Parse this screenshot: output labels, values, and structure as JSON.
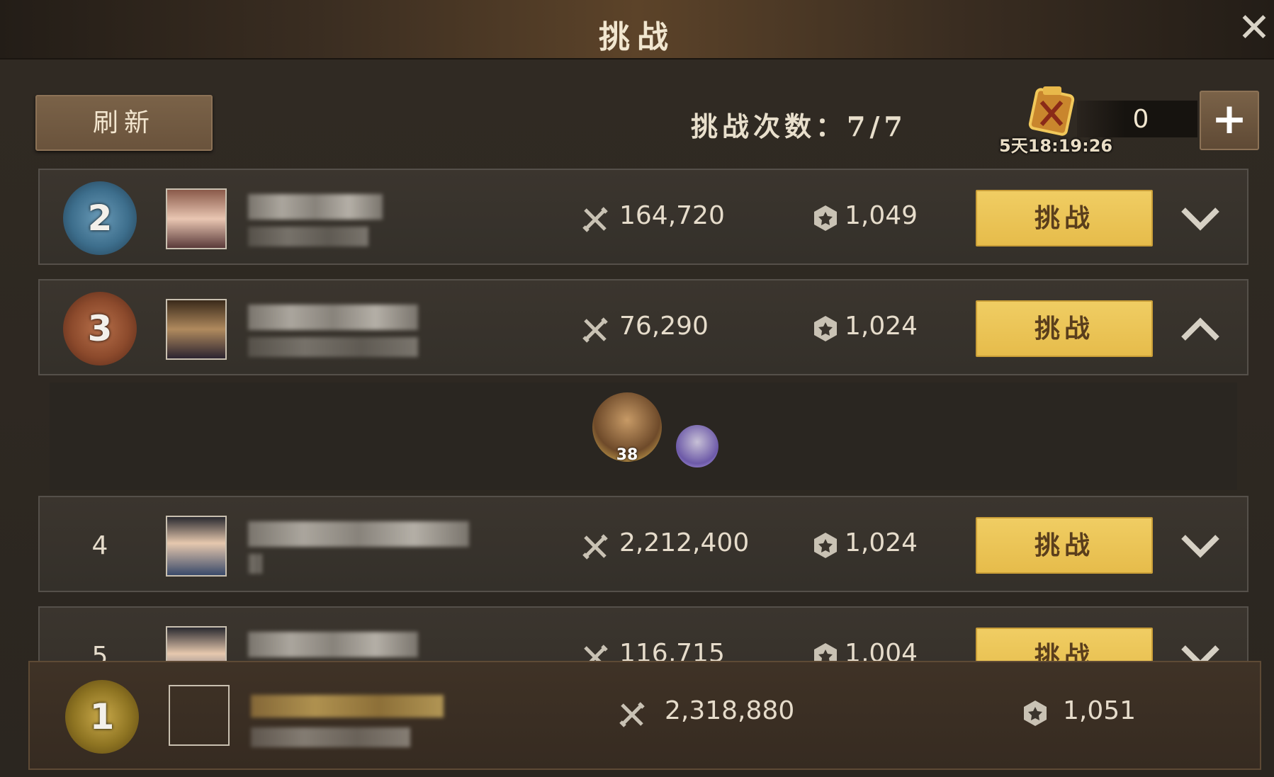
{
  "header": {
    "title": "挑战"
  },
  "toolbar": {
    "refresh_label": "刷新",
    "attempts_text": "挑战次数：7/7",
    "token_count": "0",
    "token_timer": "5天18:19:26",
    "plus_label": "+"
  },
  "rows": [
    {
      "rank": "2",
      "power": "164,720",
      "score": "1,049",
      "button": "挑战",
      "chevron": "down"
    },
    {
      "rank": "3",
      "power": "76,290",
      "score": "1,024",
      "button": "挑战",
      "chevron": "up"
    },
    {
      "rank": "4",
      "power": "2,212,400",
      "score": "1,024",
      "button": "挑战",
      "chevron": "down"
    },
    {
      "rank": "5",
      "power": "116,715",
      "score": "1,004",
      "button": "挑战",
      "chevron": "down"
    }
  ],
  "expanded": {
    "hero_level": "38"
  },
  "self": {
    "rank": "1",
    "power": "2,318,880",
    "score": "1,051"
  },
  "colors": {
    "gold_button": "#e6bc4b",
    "panel": "#2a2520",
    "accent": "#f1e6cf"
  }
}
